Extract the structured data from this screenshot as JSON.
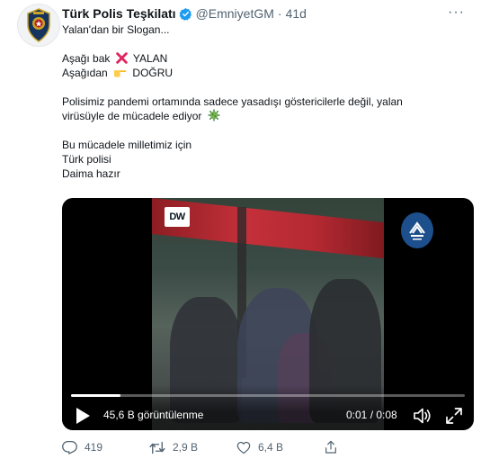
{
  "tweet": {
    "author": {
      "display_name": "Türk Polis Teşkilatı",
      "handle": "@EmniyetGM",
      "separator": "·",
      "time": "41d",
      "avatar_icon": "police-badge-icon",
      "verified_icon": "verified-badge-icon"
    },
    "more_label": "···",
    "text": {
      "line1": "Yalan'dan bir Slogan...",
      "line2_prefix": "Aşağı bak",
      "line2_emoji": "cross-mark-icon",
      "line2_suffix": "YALAN",
      "line3_prefix": "Aşağıdan",
      "line3_emoji": "pointing-hand-icon",
      "line3_suffix": "DOĞRU",
      "line4": "Polisimiz pandemi ortamında sadece yasadışı göstericilerle değil, yalan",
      "line5": "virüsüyle de mücadele ediyor",
      "line5_emoji": "virus-icon",
      "line6": "Bu mücadele milletimiz için",
      "line7": "Türk polisi",
      "line8": "Daima hazır"
    },
    "video": {
      "dw_logo": "DW",
      "ajans_logo_icon": "ajans-haber-logo-icon",
      "views": "45,6 B görüntülenme",
      "timecode": "0:01 / 0:08",
      "progress": 0.125
    },
    "actions": {
      "reply_count": "419",
      "retweet_count": "2,9 B",
      "like_count": "6,4 B"
    },
    "colors": {
      "text": "#0f1419",
      "secondary": "#536471",
      "verified": "#1d9bf0",
      "cross": "#e0245e"
    }
  }
}
